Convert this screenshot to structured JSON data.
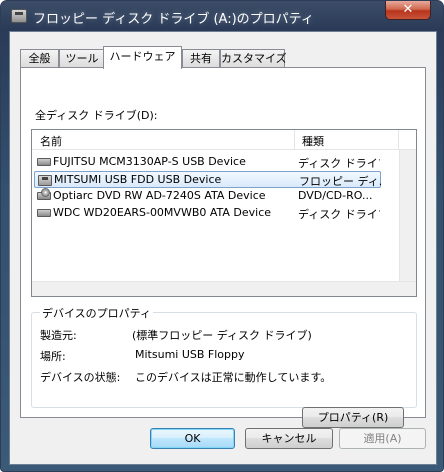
{
  "window": {
    "title": "フロッピー ディスク ドライブ (A:)のプロパティ",
    "close_label": "✕"
  },
  "tabs": [
    {
      "label": "全般"
    },
    {
      "label": "ツール"
    },
    {
      "label": "ハードウェア",
      "active": true
    },
    {
      "label": "共有"
    },
    {
      "label": "カスタマイズ"
    }
  ],
  "drives_label": "全ディスク ドライブ(D):",
  "list": {
    "columns": [
      "名前",
      "種類"
    ],
    "rows": [
      {
        "name": "FUJITSU MCM3130AP-S USB Device",
        "type": "ディスク ドライブ",
        "icon": "hard-drive-icon"
      },
      {
        "name": "MITSUMI USB FDD USB Device",
        "type": "フロッピー ディ...",
        "icon": "floppy-drive-icon",
        "selected": true
      },
      {
        "name": "Optiarc DVD RW AD-7240S ATA Device",
        "type": "DVD/CD-RO...",
        "icon": "dvd-drive-icon"
      },
      {
        "name": "WDC WD20EARS-00MVWB0 ATA Device",
        "type": "ディスク ドライブ",
        "icon": "hard-drive-icon"
      }
    ]
  },
  "device_properties": {
    "title": "デバイスのプロパティ",
    "manufacturer_label": "製造元:",
    "manufacturer_value": "(標準フロッピー ディスク ドライブ)",
    "location_label": "場所:",
    "location_value": "Mitsumi USB Floppy",
    "status_label": "デバイスの状態:",
    "status_value": "このデバイスは正常に動作しています。",
    "properties_button": "プロパティ(R)"
  },
  "buttons": {
    "ok": "OK",
    "cancel": "キャンセル",
    "apply": "適用(A)"
  },
  "colors": {
    "selection_border": "#7da2ce",
    "default_button_border": "#3c7fb1",
    "close_button": "#c8543a"
  }
}
